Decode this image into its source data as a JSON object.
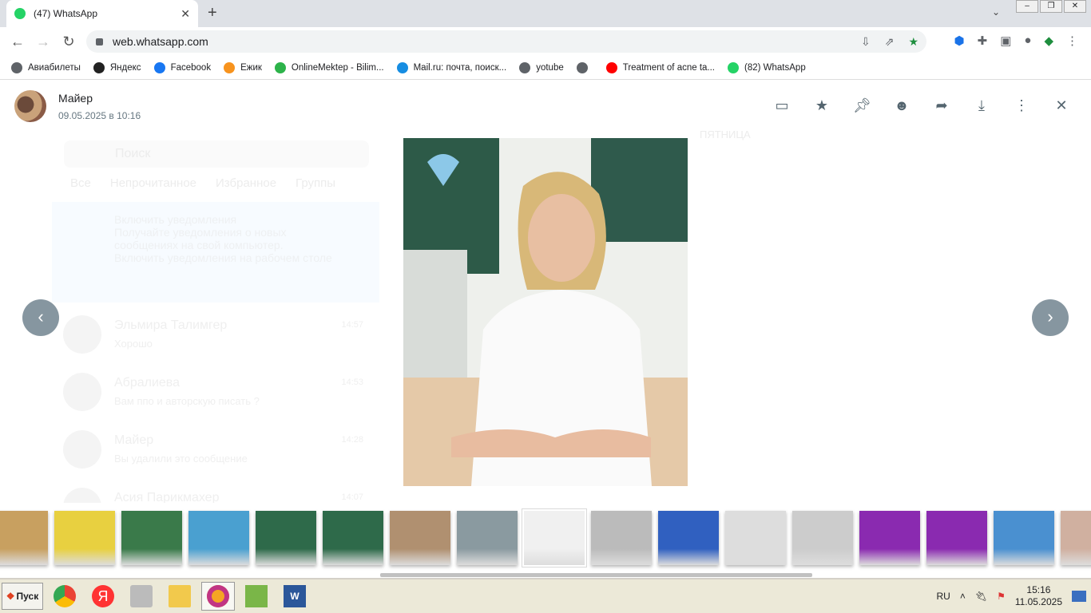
{
  "browser": {
    "tab_title": "(47) WhatsApp",
    "url": "web.whatsapp.com",
    "bookmarks": [
      {
        "label": "Авиабилеты",
        "color": "#5f6368"
      },
      {
        "label": "Яндекс",
        "color": "#222"
      },
      {
        "label": "Facebook",
        "color": "#1877f2"
      },
      {
        "label": "Ежик",
        "color": "#f7931e"
      },
      {
        "label": "OnlineMektep - Bilim...",
        "color": "#2db34a"
      },
      {
        "label": "Mail.ru: почта, поиск...",
        "color": "#168de2"
      },
      {
        "label": "yotube",
        "color": "#5f6368"
      },
      {
        "label": "",
        "color": "#5f6368"
      },
      {
        "label": "Treatment of acne ta...",
        "color": "#ff0000"
      },
      {
        "label": "(82) WhatsApp",
        "color": "#25d366"
      }
    ]
  },
  "viewer": {
    "sender": "Майер",
    "date": "09.05.2025 в 10:16",
    "prev": "‹",
    "next": "›"
  },
  "background": {
    "search_placeholder": "Поиск",
    "filters": [
      "Все",
      "Непрочитанное",
      "Избранное",
      "Группы"
    ],
    "notice_title": "Включить уведомления",
    "notice_body": "Получайте уведомления о новых сообщениях на свой компьютер.",
    "notice_link": "Включить уведомления на рабочем столе",
    "chats": [
      {
        "name": "Эльмира Талимгер",
        "msg": "Хорошо",
        "time": "14:57"
      },
      {
        "name": "Абралиева",
        "msg": "Вам ппо и авторскую писать ?",
        "time": "14:53"
      },
      {
        "name": "Майер",
        "msg": "Вы удалили это сообщение",
        "time": "14:28"
      },
      {
        "name": "Асия Парикмахер",
        "msg": "",
        "time": "14:07"
      }
    ],
    "day_label": "ПЯТНИЦА"
  },
  "thumbnails": [
    "#c8a060",
    "#e8d040",
    "#3a7a4a",
    "#4aa0d0",
    "#2e6a4a",
    "#2e6a4a",
    "#b09070",
    "#8a9aa0",
    "#f0f0f0",
    "#bbb",
    "#3060c0",
    "#ddd",
    "#ccc",
    "#8a2ab0",
    "#8a2ab0",
    "#4a90d0",
    "#d0b0a0"
  ],
  "taskbar": {
    "start": "Пуск",
    "lang": "RU",
    "time": "15:16",
    "date": "11.05.2025"
  }
}
